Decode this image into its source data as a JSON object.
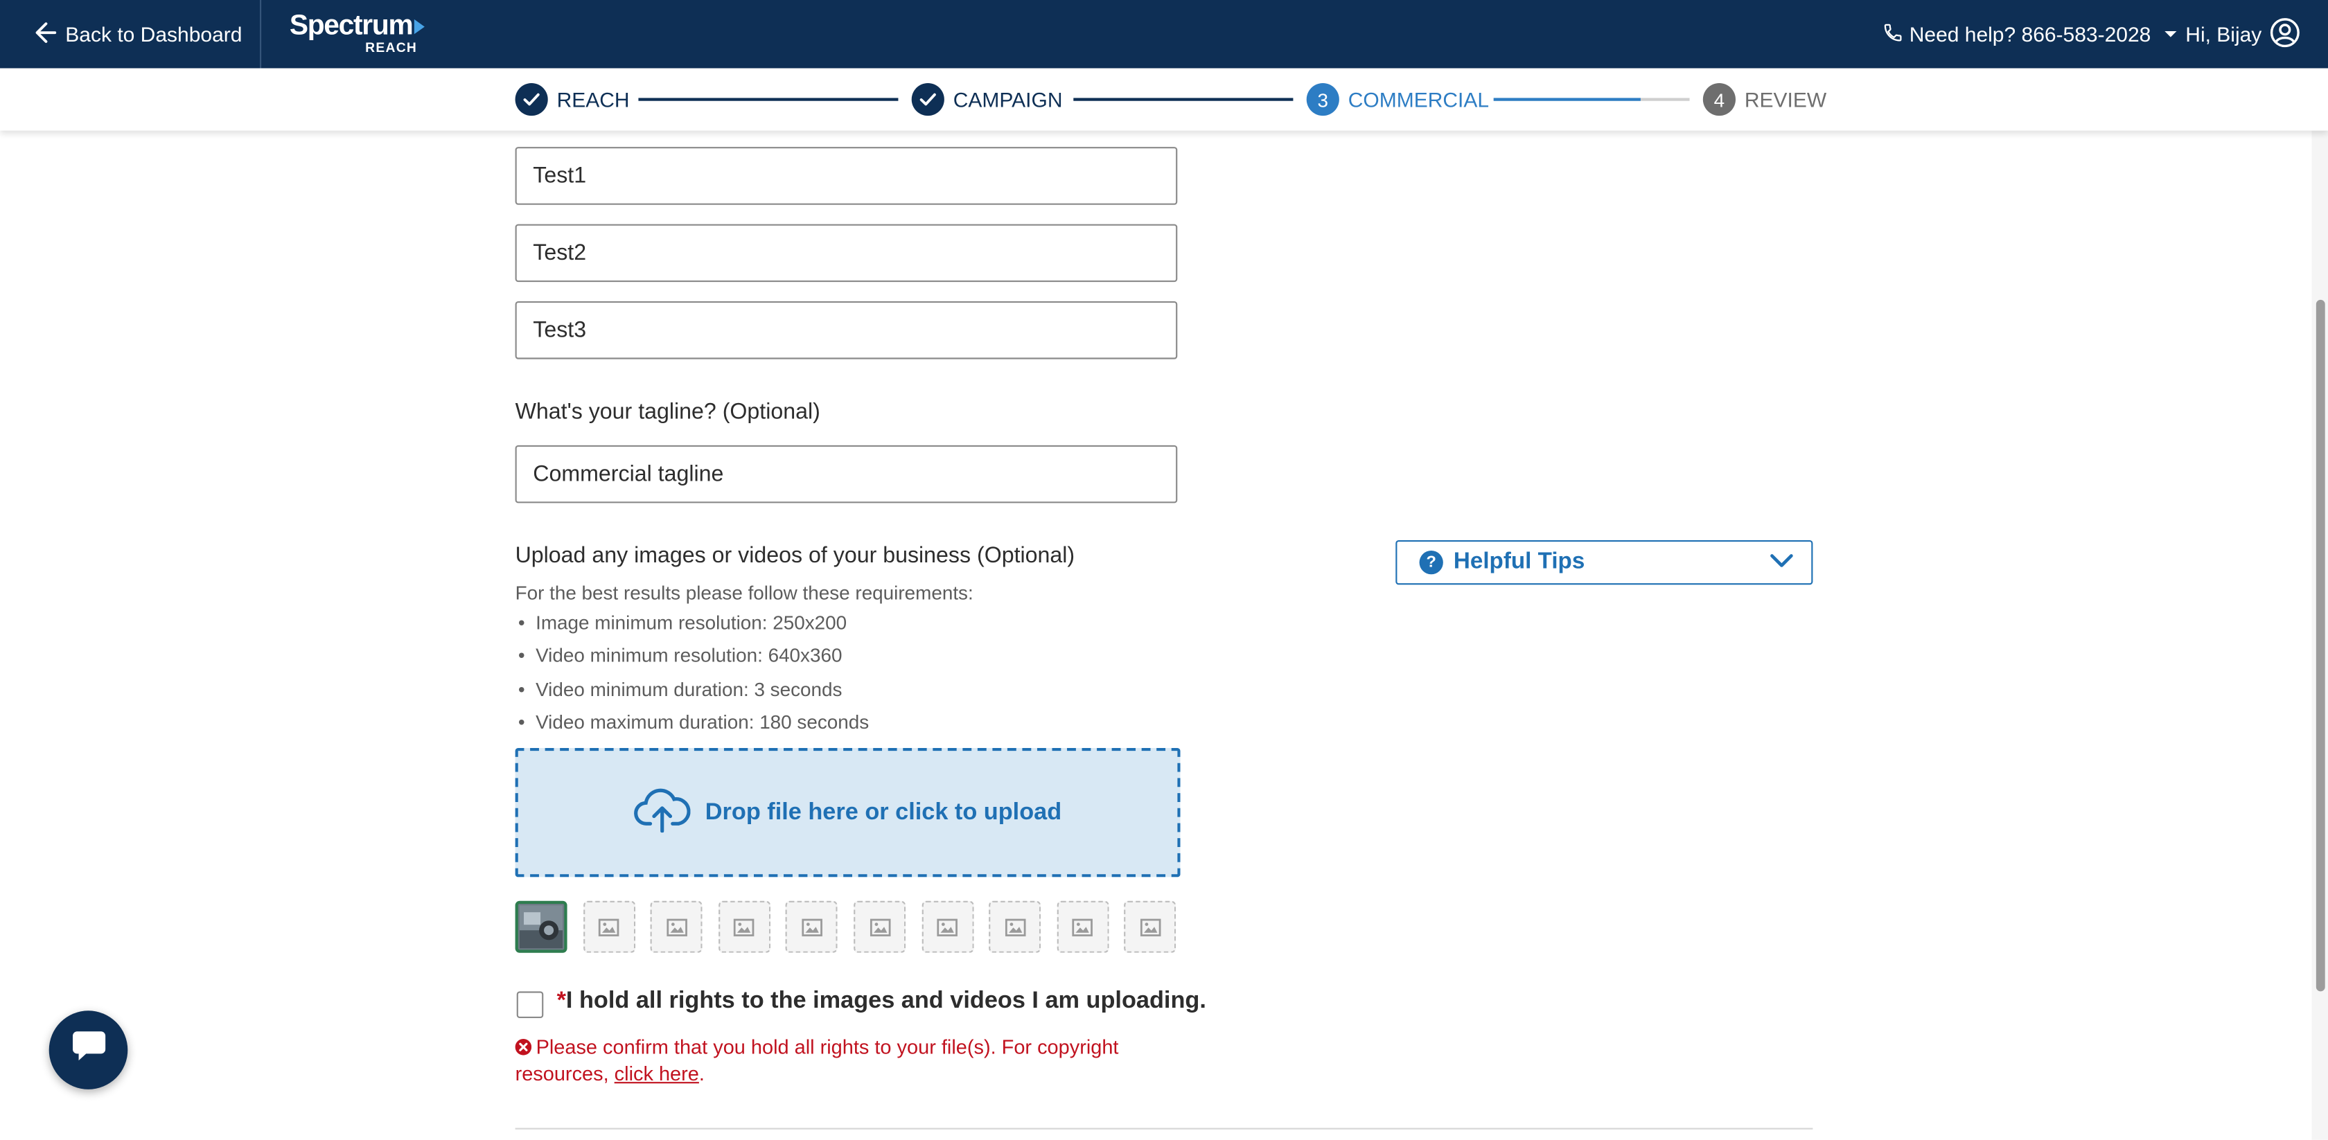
{
  "header": {
    "back_label": "Back to Dashboard",
    "logo_word": "Spectrum",
    "logo_sub": "REACH",
    "help_label": "Need help? 866-583-2028",
    "user_label": "Hi, Bijay"
  },
  "stepper": {
    "steps": [
      {
        "number": "",
        "label": "REACH",
        "state": "complete"
      },
      {
        "number": "",
        "label": "CAMPAIGN",
        "state": "complete"
      },
      {
        "number": "3",
        "label": "COMMERCIAL",
        "state": "active"
      },
      {
        "number": "4",
        "label": "REVIEW",
        "state": "upcoming"
      }
    ],
    "commercial_progress": 0.75
  },
  "form": {
    "highlights": [
      "Test1",
      "Test2",
      "Test3"
    ],
    "tagline_label": "What's your tagline? (Optional)",
    "tagline_value": "Commercial tagline",
    "upload_label": "Upload any images or videos of your business (Optional)",
    "requirements_intro": "For the best results please follow these requirements:",
    "requirements": [
      "Image minimum resolution: 250x200",
      "Video minimum resolution: 640x360",
      "Video minimum duration: 3 seconds",
      "Video maximum duration: 180 seconds"
    ],
    "dropzone_label": "Drop file here or click to upload",
    "uploaded_count": 1,
    "slot_count": 10,
    "rights_star": "*",
    "rights_label": "I hold all rights to the images and videos I am uploading.",
    "error_text": "Please confirm that you hold all rights to your file(s). For copyright resources, ",
    "error_link": "click here",
    "error_end": "."
  },
  "sidebar": {
    "tips_label": "Helpful Tips"
  },
  "colors": {
    "navy": "#0e2f55",
    "accent_blue": "#1f70b4",
    "error_red": "#c1121f"
  }
}
